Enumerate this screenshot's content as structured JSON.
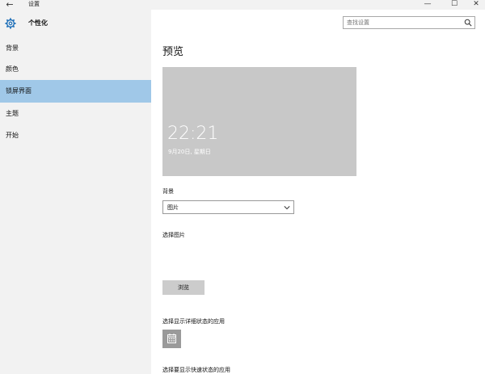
{
  "titlebar": {
    "back_glyph": "←",
    "title": "设置",
    "minimize_glyph": "—",
    "maximize_glyph": "☐",
    "close_glyph": "✕"
  },
  "sidebar": {
    "section_title": "个性化",
    "items": [
      {
        "label": "背景",
        "active": false
      },
      {
        "label": "颜色",
        "active": false
      },
      {
        "label": "锁屏界面",
        "active": true
      },
      {
        "label": "主题",
        "active": false
      },
      {
        "label": "开始",
        "active": false
      }
    ]
  },
  "search": {
    "placeholder": "查找设置",
    "value": ""
  },
  "main": {
    "heading": "预览",
    "preview": {
      "time": "22:21",
      "date": "9月20日, 星期日"
    },
    "background_label": "背景",
    "background_value": "图片",
    "choose_picture_label": "选择图片",
    "browse_label": "浏览",
    "detail_status_label": "选择显示详细状态的应用",
    "quick_status_label": "选择要显示快速状态的应用"
  },
  "colors": {
    "sidebar_bg": "#f2f2f2",
    "active_item": "#a0c8e8",
    "accent_icon": "#1e6fb8",
    "preview_bg": "#c8c8c8"
  },
  "icons": {
    "settings": "gear-icon",
    "search": "search-icon",
    "dropdown": "chevron-down-icon",
    "app_tile": "calendar-icon"
  }
}
